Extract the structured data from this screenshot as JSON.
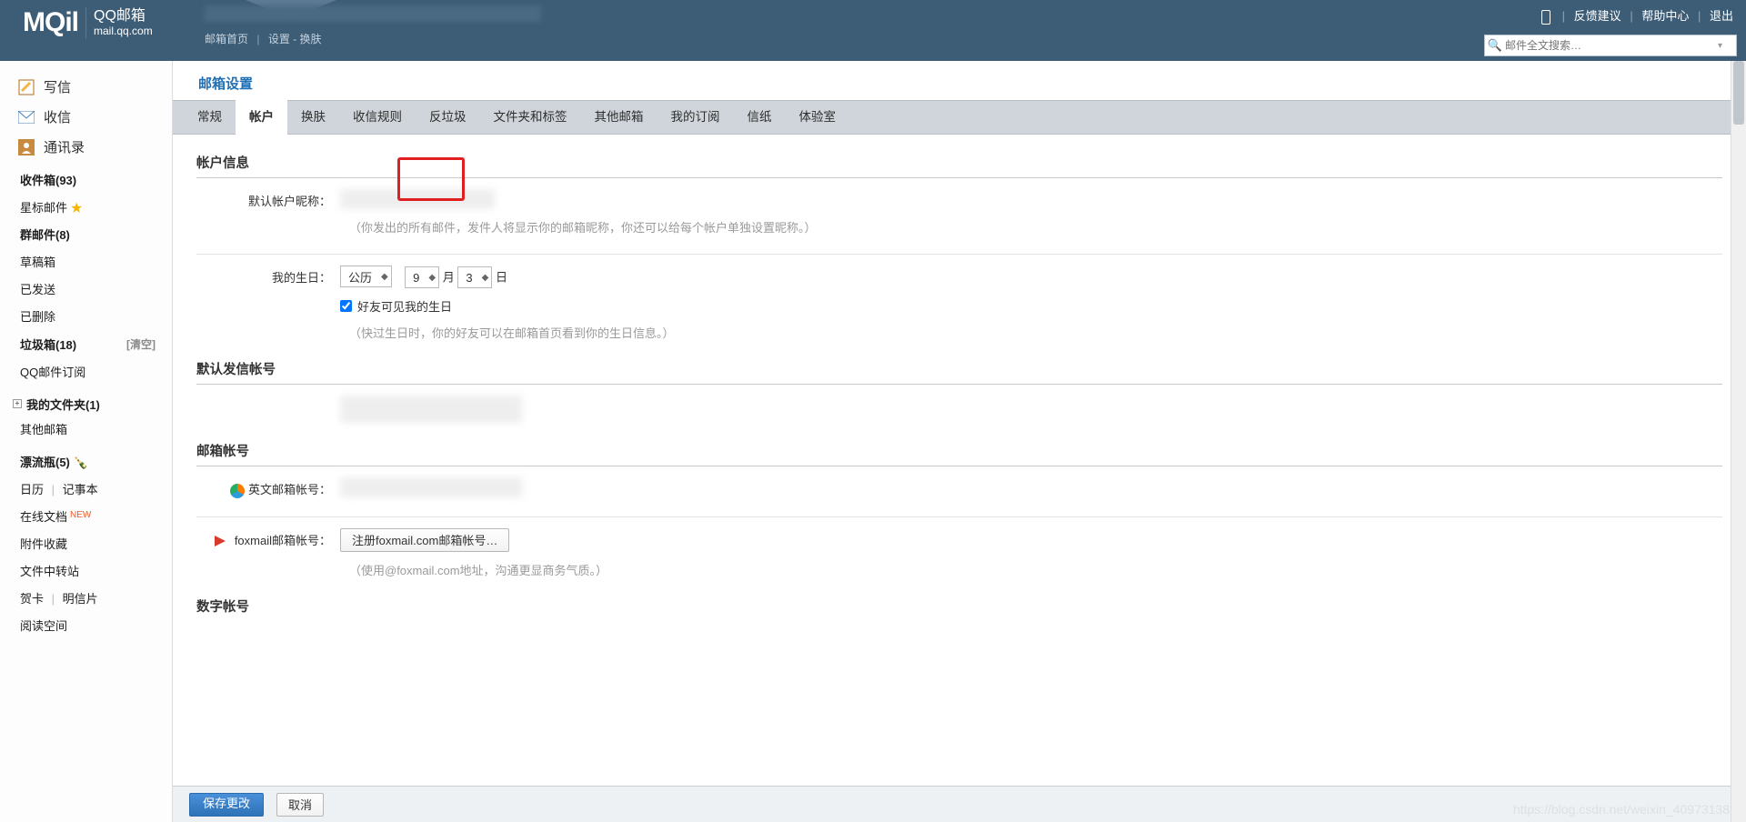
{
  "header": {
    "logo_main": "MQil",
    "logo_cn": "QQ邮箱",
    "logo_en": "mail.qq.com",
    "breadcrumb_home": "邮箱首页",
    "breadcrumb_settings": "设置",
    "breadcrumb_skin": "换肤",
    "links": {
      "feedback": "反馈建议",
      "help": "帮助中心",
      "logout": "退出"
    },
    "search_placeholder": "邮件全文搜索…"
  },
  "sidebar": {
    "compose": "写信",
    "receive": "收信",
    "contacts": "通讯录",
    "folders1": {
      "inbox": "收件箱(93)",
      "starred": "星标邮件",
      "group": "群邮件(8)",
      "drafts": "草稿箱",
      "sent": "已发送",
      "deleted": "已删除",
      "spam": "垃圾箱(18)",
      "spam_aux": "[清空]",
      "subscribe": "QQ邮件订阅"
    },
    "myfolders": "我的文件夹(1)",
    "other_mailbox": "其他邮箱",
    "folders2": {
      "drift": "漂流瓶(5)",
      "calendar": "日历",
      "notes": "记事本",
      "docs": "在线文档",
      "new_tag": "NEW",
      "attach": "附件收藏",
      "transit": "文件中转站",
      "greet": "贺卡",
      "postcard": "明信片",
      "read": "阅读空间"
    }
  },
  "main": {
    "page_title": "邮箱设置",
    "tabs": [
      "常规",
      "帐户",
      "换肤",
      "收信规则",
      "反垃圾",
      "文件夹和标签",
      "其他邮箱",
      "我的订阅",
      "信纸",
      "体验室"
    ],
    "active_tab_index": 1,
    "section_account_info": "帐户信息",
    "nickname_label": "默认帐户昵称：",
    "nickname_hint": "（你发出的所有邮件，发件人将显示你的邮箱昵称，你还可以给每个帐户单独设置昵称。）",
    "birthday_label": "我的生日：",
    "birthday_calendar": "公历",
    "birthday_month": "9",
    "birthday_month_unit": "月",
    "birthday_day": "3",
    "birthday_day_unit": "日",
    "birthday_visible": "好友可见我的生日",
    "birthday_hint": "（快过生日时，你的好友可以在邮箱首页看到你的生日信息。）",
    "section_default_sender": "默认发信帐号",
    "section_mail_accounts": "邮箱帐号",
    "en_mail_label": "英文邮箱帐号：",
    "foxmail_label": "foxmail邮箱帐号：",
    "foxmail_btn": "注册foxmail.com邮箱帐号…",
    "foxmail_hint": "（使用@foxmail.com地址，沟通更显商务气质。）",
    "section_digit": "数字帐号",
    "save_btn": "保存更改",
    "cancel_btn": "取消",
    "watermark": "https://blog.csdn.net/weixin_40973138"
  }
}
